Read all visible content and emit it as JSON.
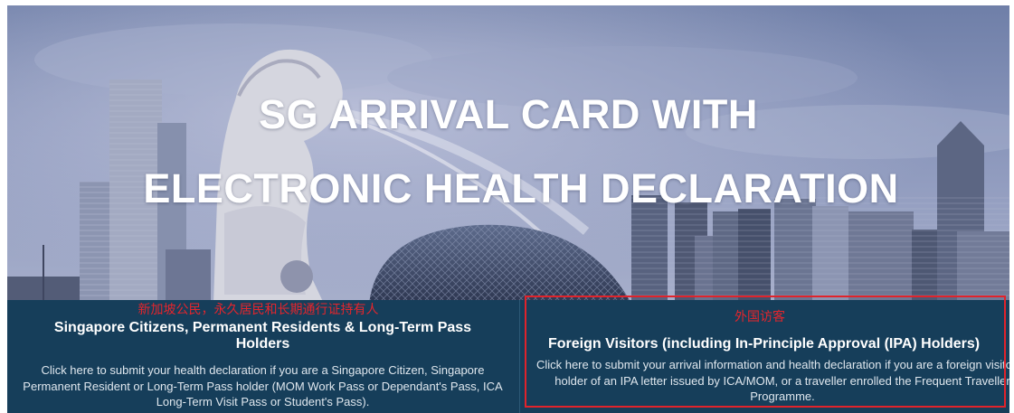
{
  "hero": {
    "title_line1": "SG ARRIVAL CARD WITH",
    "title_line2": "ELECTRONIC HEALTH DECLARATION"
  },
  "panels": {
    "residents": {
      "chinese_label": "新加坡公民，永久居民和长期通行证持有人",
      "heading": "Singapore Citizens, Permanent Residents & Long-Term Pass Holders",
      "description": "Click here to submit your health declaration if you are a Singapore Citizen, Singapore Permanent Resident or Long-Term Pass holder (MOM Work Pass or Dependant's Pass, ICA Long-Term Visit Pass or Student's Pass)."
    },
    "visitors": {
      "chinese_label": "外国访客",
      "heading": "Foreign Visitors (including In-Principle Approval (IPA) Holders)",
      "description": "Click here to submit your arrival information and health declaration if you are a foreign visitor, a holder of an IPA letter issued by ICA/MOM, or a traveller enrolled the Frequent Traveller Programme."
    }
  },
  "colors": {
    "panel_background": "#163e5a",
    "chinese_label_red": "#e5252c",
    "highlight_border": "#e1232b"
  }
}
